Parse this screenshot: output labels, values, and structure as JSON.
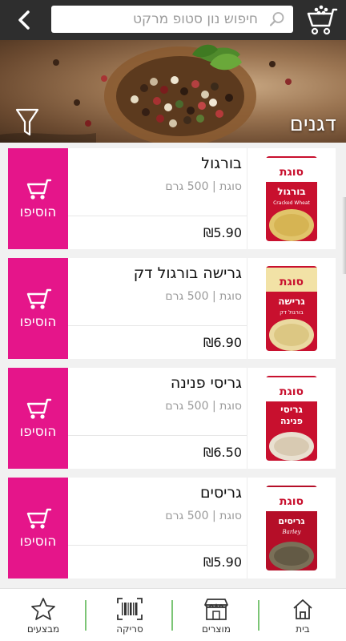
{
  "header": {
    "search_placeholder": "חיפוש נון סטופ מרקט"
  },
  "banner": {
    "title": "דגנים"
  },
  "products": [
    {
      "name": "בורגול",
      "brand": "סוגת",
      "weight": "500 גרם",
      "price": "₪5.90",
      "add_label": "הוסיפו",
      "pack_brand": "סוגת",
      "pack_title": "בורגול",
      "pack_sub": "Cracked Wheat"
    },
    {
      "name": "גרישה בורגול דק",
      "brand": "סוגת",
      "weight": "500 גרם",
      "price": "₪6.90",
      "add_label": "הוסיפו",
      "pack_brand": "סוגת",
      "pack_title": "גרישה",
      "pack_sub": "בורגול דק"
    },
    {
      "name": "גריסי פנינה",
      "brand": "סוגת",
      "weight": "500 גרם",
      "price": "₪6.50",
      "add_label": "הוסיפו",
      "pack_brand": "סוגת",
      "pack_title": "גריסי",
      "pack_sub": "פנינה"
    },
    {
      "name": "גריסים",
      "brand": "סוגת",
      "weight": "500 גרם",
      "price": "₪5.90",
      "add_label": "הוסיפו",
      "pack_brand": "סוגת",
      "pack_title": "גריסים",
      "pack_sub": "Barley"
    }
  ],
  "nav": [
    {
      "label": "בית",
      "icon": "home-icon"
    },
    {
      "label": "מוצרים",
      "icon": "store-icon"
    },
    {
      "label": "סריקה",
      "icon": "barcode-scan-icon"
    },
    {
      "label": "מבצעים",
      "icon": "star-icon"
    }
  ],
  "colors": {
    "accent": "#e5158a",
    "topbar": "#2e2e2e",
    "nav_separator": "#7cc576"
  }
}
